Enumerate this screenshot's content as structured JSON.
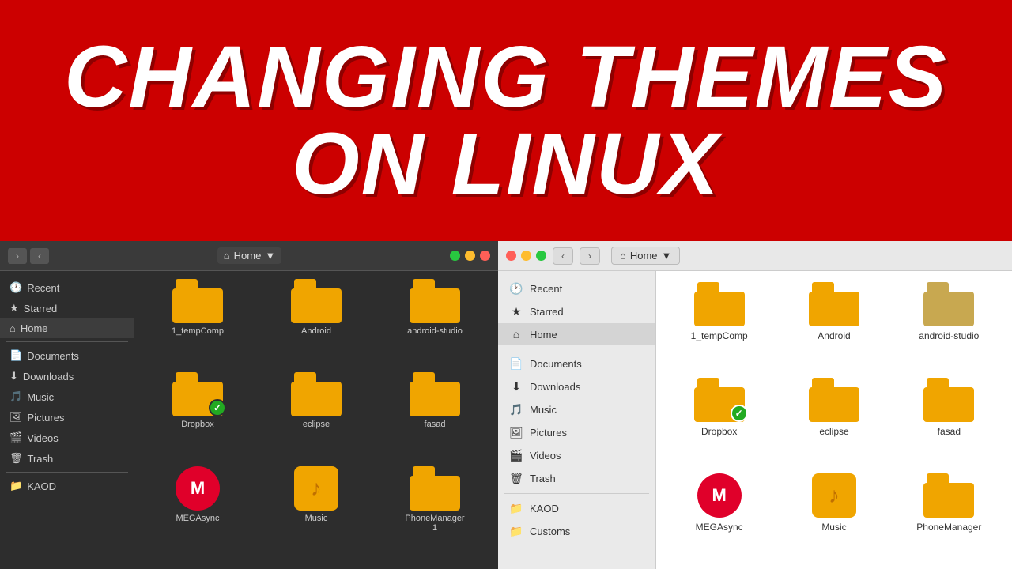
{
  "banner": {
    "line1": "CHANGING THEMES",
    "line2": "ON LINUX"
  },
  "dark_window": {
    "title": "Home",
    "nav_back": "‹",
    "nav_forward": "›",
    "sidebar": [
      {
        "id": "recent",
        "label": "Recent",
        "icon": "🕐"
      },
      {
        "id": "starred",
        "label": "Starred",
        "icon": "★"
      },
      {
        "id": "home",
        "label": "Home",
        "icon": "⌂",
        "active": true
      },
      {
        "id": "documents",
        "label": "Documents",
        "icon": "📄"
      },
      {
        "id": "downloads",
        "label": "Downloads",
        "icon": "⬇"
      },
      {
        "id": "music",
        "label": "Music",
        "icon": "🎵"
      },
      {
        "id": "pictures",
        "label": "Pictures",
        "icon": "🖼"
      },
      {
        "id": "videos",
        "label": "Videos",
        "icon": "🎬"
      },
      {
        "id": "trash",
        "label": "Trash",
        "icon": "🗑"
      },
      {
        "id": "kaod",
        "label": "KAOD",
        "icon": "📁"
      }
    ],
    "folders": [
      {
        "id": "android-studio",
        "name": "android-studio",
        "type": "folder"
      },
      {
        "id": "android",
        "name": "Android",
        "type": "folder"
      },
      {
        "id": "1tempcomp",
        "name": "1_tempComp",
        "type": "folder"
      },
      {
        "id": "fasad",
        "name": "fasad",
        "type": "folder"
      },
      {
        "id": "eclipse",
        "name": "eclipse",
        "type": "folder"
      },
      {
        "id": "dropbox",
        "name": "Dropbox",
        "type": "dropbox"
      },
      {
        "id": "phonemanager",
        "name": "PhoneManager1",
        "type": "folder"
      },
      {
        "id": "music-app",
        "name": "Music",
        "type": "music"
      },
      {
        "id": "megasync",
        "name": "MEGAsync",
        "type": "mega"
      }
    ]
  },
  "light_window": {
    "title": "Home",
    "sidebar": [
      {
        "id": "recent",
        "label": "Recent",
        "icon": "🕐"
      },
      {
        "id": "starred",
        "label": "Starred",
        "icon": "★"
      },
      {
        "id": "home",
        "label": "Home",
        "icon": "⌂",
        "active": true
      },
      {
        "id": "documents",
        "label": "Documents",
        "icon": "📄"
      },
      {
        "id": "downloads",
        "label": "Downloads",
        "icon": "⬇"
      },
      {
        "id": "music",
        "label": "Music",
        "icon": "🎵"
      },
      {
        "id": "pictures",
        "label": "Pictures",
        "icon": "🖼"
      },
      {
        "id": "videos",
        "label": "Videos",
        "icon": "🎬"
      },
      {
        "id": "trash",
        "label": "Trash",
        "icon": "🗑"
      },
      {
        "id": "kaod",
        "label": "KAOD",
        "icon": "📁"
      },
      {
        "id": "customs",
        "label": "Customs",
        "icon": "📁"
      }
    ],
    "folders": [
      {
        "id": "1tempcomp",
        "name": "1_tempComp",
        "type": "folder"
      },
      {
        "id": "android",
        "name": "Android",
        "type": "folder"
      },
      {
        "id": "android-studio",
        "name": "android-studio",
        "type": "folder"
      },
      {
        "id": "dropbox",
        "name": "Dropbox",
        "type": "dropbox"
      },
      {
        "id": "eclipse",
        "name": "eclipse",
        "type": "folder"
      },
      {
        "id": "fasad",
        "name": "fasad",
        "type": "folder"
      },
      {
        "id": "megasync",
        "name": "MEGAsync",
        "type": "mega"
      },
      {
        "id": "music-app",
        "name": "Music",
        "type": "music"
      },
      {
        "id": "phonemanager",
        "name": "PhoneManager",
        "type": "folder"
      }
    ]
  }
}
